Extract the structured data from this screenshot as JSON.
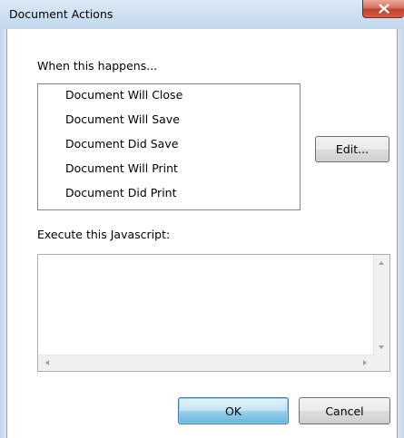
{
  "window": {
    "title": "Document Actions",
    "close_glyph": "X"
  },
  "trigger": {
    "label": "When this happens...",
    "items": [
      {
        "label": "Document Will Close"
      },
      {
        "label": "Document Will Save"
      },
      {
        "label": "Document Did Save"
      },
      {
        "label": "Document Will Print"
      },
      {
        "label": "Document Did Print"
      }
    ],
    "edit_button": "Edit..."
  },
  "script": {
    "label": "Execute this Javascript:",
    "value": ""
  },
  "footer": {
    "ok_label": "OK",
    "cancel_label": "Cancel"
  },
  "colors": {
    "titlebar": "#cfe0f2",
    "close_button": "#c2412b",
    "default_button_border": "#3c7fb1"
  },
  "icons": {
    "close": "close-icon",
    "scroll_up": "scroll-up-arrow-icon",
    "scroll_down": "scroll-down-arrow-icon",
    "scroll_left": "scroll-left-arrow-icon",
    "scroll_right": "scroll-right-arrow-icon"
  }
}
